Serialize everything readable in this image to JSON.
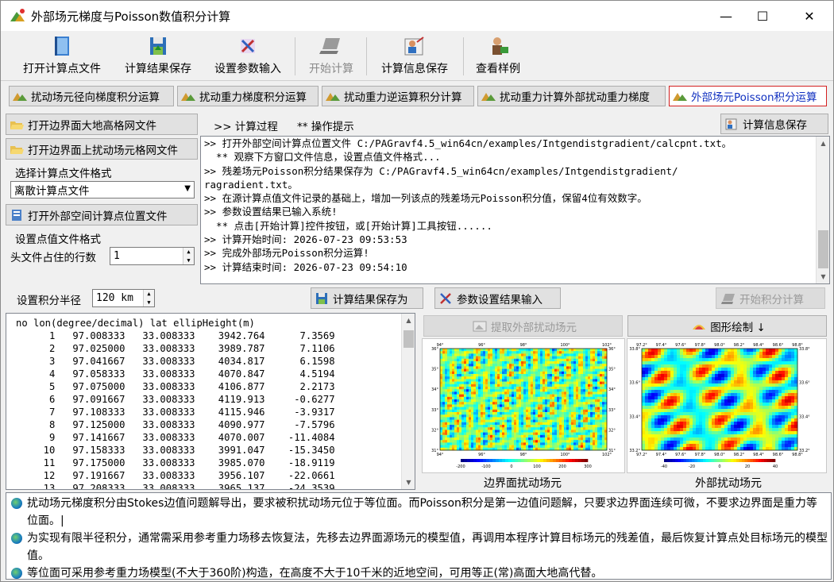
{
  "window": {
    "title": "外部场元梯度与Poisson数值积分计算",
    "min": "—",
    "max": "☐",
    "close": "✕"
  },
  "toolbar": [
    {
      "label": "打开计算点文件",
      "icon": "open-book-icon",
      "enabled": true
    },
    {
      "label": "计算结果保存",
      "icon": "save-disk-icon",
      "enabled": true
    },
    {
      "label": "设置参数输入",
      "icon": "settings-tools-icon",
      "enabled": true
    },
    {
      "label": "开始计算",
      "icon": "laptop-icon",
      "enabled": false
    },
    {
      "label": "计算信息保存",
      "icon": "user-report-icon",
      "enabled": true
    },
    {
      "label": "查看样例",
      "icon": "teacher-icon",
      "enabled": true
    }
  ],
  "tabs": [
    {
      "label": "扰动场元径向梯度积分运算"
    },
    {
      "label": "扰动重力梯度积分运算"
    },
    {
      "label": "扰动重力逆运算积分计算"
    },
    {
      "label": "扰动重力计算外部扰动重力梯度"
    },
    {
      "label": "外部场元Poisson积分运算",
      "active": true
    }
  ],
  "left": {
    "open_boundary_grid": "打开边界面大地高格网文件",
    "open_boundary_field_grid": "打开边界面上扰动场元格网文件",
    "format_label": "选择计算点文件格式",
    "format_value": "离散计算点文件",
    "open_points_file": "打开外部空间计算点位置文件",
    "value_format_label": "设置点值文件格式",
    "header_lines_label": "头文件占住的行数",
    "header_lines_value": "1"
  },
  "log_header": {
    "process": ">> 计算过程",
    "tips": "** 操作提示",
    "save_info": "计算信息保存"
  },
  "log": [
    ">> 打开外部空间计算点位置文件 C:/PAGravf4.5_win64cn/examples/Intgendistgradient/calcpnt.txt。",
    "  ** 观察下方窗口文件信息，设置点值文件格式...",
    ">> 残差场元Poisson积分结果保存为 C:/PAGravf4.5_win64cn/examples/Intgendistgradient/",
    "ragradient.txt。",
    ">> 在源计算点值文件记录的基础上，增加一列该点的残差场元Poisson积分值，保留4位有效数字。",
    ">> 参数设置结果已输入系统!",
    "  ** 点击[开始计算]控件按钮，或[开始计算]工具按钮......",
    ">> 计算开始时间: 2026-07-23 09:53:53",
    ">> 完成外部场元Poisson积分运算!",
    ">> 计算结束时间: 2026-07-23 09:54:10"
  ],
  "controls": {
    "radius_label": "设置积分半径",
    "radius_value": "120 km",
    "save_result_as": "计算结果保存为",
    "param_input": "参数设置结果输入",
    "start_integral": "开始积分计算",
    "extract_field": "提取外部扰动场元",
    "draw_graph": "图形绘制 ↓"
  },
  "table": {
    "header": "no lon(degree/decimal) lat ellipHeight(m)",
    "rows": [
      [
        "1",
        "97.008333",
        "33.008333",
        "3942.764",
        "7.3569"
      ],
      [
        "2",
        "97.025000",
        "33.008333",
        "3989.787",
        "7.1106"
      ],
      [
        "3",
        "97.041667",
        "33.008333",
        "4034.817",
        "6.1598"
      ],
      [
        "4",
        "97.058333",
        "33.008333",
        "4070.847",
        "4.5194"
      ],
      [
        "5",
        "97.075000",
        "33.008333",
        "4106.877",
        "2.2173"
      ],
      [
        "6",
        "97.091667",
        "33.008333",
        "4119.913",
        "-0.6277"
      ],
      [
        "7",
        "97.108333",
        "33.008333",
        "4115.946",
        "-3.9317"
      ],
      [
        "8",
        "97.125000",
        "33.008333",
        "4090.977",
        "-7.5796"
      ],
      [
        "9",
        "97.141667",
        "33.008333",
        "4070.007",
        "-11.4084"
      ],
      [
        "10",
        "97.158333",
        "33.008333",
        "3991.047",
        "-15.3450"
      ],
      [
        "11",
        "97.175000",
        "33.008333",
        "3985.070",
        "-18.9119"
      ],
      [
        "12",
        "97.191667",
        "33.008333",
        "3956.107",
        "-22.0661"
      ],
      [
        "13",
        "97.208333",
        "33.008333",
        "3965.137",
        "-24.3539"
      ]
    ]
  },
  "plots": {
    "left_caption": "边界面扰动场元",
    "right_caption": "外部扰动场元",
    "left_xticks": [
      "94°",
      "96°",
      "98°",
      "100°",
      "102°"
    ],
    "left_yticks": [
      "36°",
      "35°",
      "34°",
      "33°",
      "32°",
      "31°"
    ],
    "left_cbar": [
      "-200",
      "-100",
      "0",
      "100",
      "200",
      "300"
    ],
    "right_xticks": [
      "97.2°",
      "97.4°",
      "97.6°",
      "97.8°",
      "98.0°",
      "98.2°",
      "98.4°",
      "98.6°",
      "98.8°"
    ],
    "right_yticks": [
      "33.8°",
      "33.6°",
      "33.4°",
      "33.2°"
    ],
    "right_cbar": [
      "-40",
      "-20",
      "0",
      "20",
      "40"
    ]
  },
  "notes": [
    "扰动场元梯度积分由Stokes边值问题解导出，要求被积扰动场元位于等位面。而Poisson积分是第一边值问题解，只要求边界面连续可微，不要求边界面是重力等位面。|",
    "为实现有限半径积分，通常需采用参考重力场移去恢复法，先移去边界面源场元的模型值，再调用本程序计算目标场元的残差值，最后恢复计算点处目标场元的模型值。",
    "等位面可采用参考重力场模型(不大于360阶)构造，在高度不大于10千米的近地空间，可用等正(常)高面大地高代替。"
  ]
}
